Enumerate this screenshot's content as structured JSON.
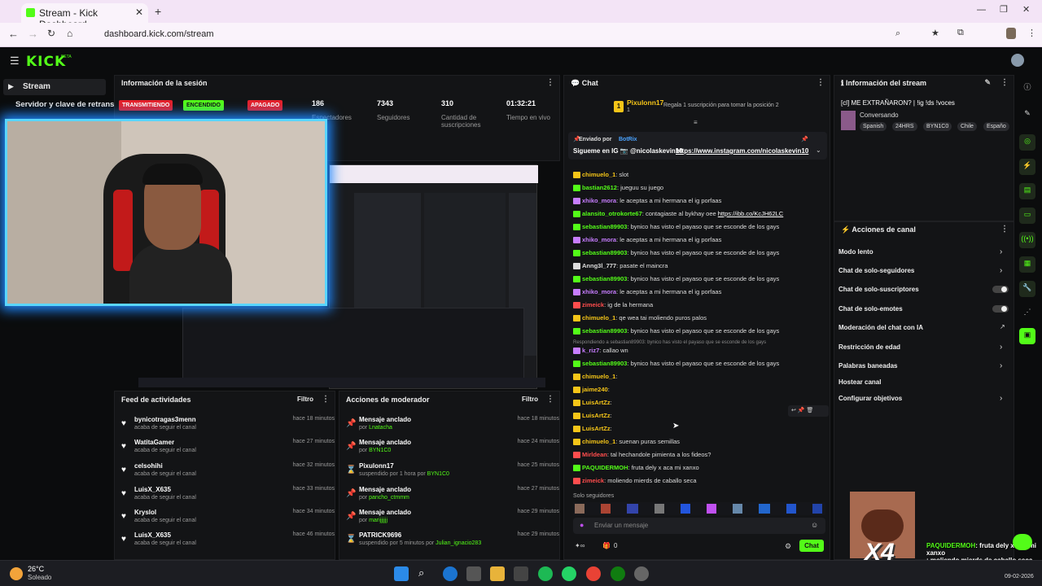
{
  "browser": {
    "tab_title": "Stream - Kick Dashboard",
    "url": "dashboard.kick.com/stream"
  },
  "kick": {
    "logo": "KICK",
    "logo_sub": "BETA"
  },
  "nav": {
    "stream": "Stream",
    "server": "Servidor y clave de retransm"
  },
  "session": {
    "title": "Información de la sesión",
    "badge1": "TRANSMITIENDO",
    "badge2": "ENCENDIDO",
    "badge3": "APAGADO",
    "stats": [
      {
        "n": "186",
        "l": "Espectadores"
      },
      {
        "n": "7343",
        "l": "Seguidores"
      },
      {
        "n": "310",
        "l": "Cantidad de suscripciones"
      },
      {
        "n": "01:32:21",
        "l": "Tiempo en vivo"
      }
    ]
  },
  "feed": {
    "title": "Feed de actividades",
    "filter": "Filtro",
    "items": [
      {
        "name": "bynicotragas3menn",
        "sub": "acaba de seguir el canal",
        "time": "hace 18 minutos"
      },
      {
        "name": "WatitaGamer",
        "sub": "acaba de seguir el canal",
        "time": "hace 27 minutos"
      },
      {
        "name": "celsohihi",
        "sub": "acaba de seguir el canal",
        "time": "hace 32 minutos"
      },
      {
        "name": "LuisX_X635",
        "sub": "acaba de seguir el canal",
        "time": "hace 33 minutos"
      },
      {
        "name": "Kryslol",
        "sub": "acaba de seguir el canal",
        "time": "hace 34 minutos"
      },
      {
        "name": "LuisX_X635",
        "sub": "acaba de seguir el canal",
        "time": "hace 46 minutos"
      }
    ]
  },
  "mod": {
    "title": "Acciones de moderador",
    "filter": "Filtro",
    "items": [
      {
        "name": "Mensaje anclado",
        "by": "por ",
        "who": "Lnatacha",
        "time": "hace 18 minutos",
        "icon": "pin"
      },
      {
        "name": "Mensaje anclado",
        "by": "por ",
        "who": "BYN1C0",
        "time": "hace 24 minutos",
        "icon": "pin"
      },
      {
        "name": "Pixulonn17",
        "by": "suspendido por 1 hora por ",
        "who": "BYN1C0",
        "time": "hace 25 minutos",
        "icon": "timer"
      },
      {
        "name": "Mensaje anclado",
        "by": "por ",
        "who": "pancho_ctmmm",
        "time": "hace 27 minutos",
        "icon": "pin"
      },
      {
        "name": "Mensaje anclado",
        "by": "por ",
        "who": "marijjjjjj",
        "time": "hace 29 minutos",
        "icon": "pin"
      },
      {
        "name": "PATRICK9696",
        "by": "suspendido por 5 minutos por ",
        "who": "Julian_ignacio283",
        "time": "hace 29 minutos",
        "icon": "timer"
      }
    ]
  },
  "chat": {
    "title": "Chat",
    "top_user": "Pixulonn17",
    "top_count": "1",
    "gift_text": "Regala 1 suscripción para tomar la posición 2",
    "pinned_by": "Enviado por",
    "pinned_bot": "BotRix",
    "pinned_msg": "Sigueme en IG 📷 @nicolaskevin10",
    "pinned_link": "https://www.instagram.com/nicolaskevin10",
    "messages": [
      {
        "u": "chimuelo_1",
        "c": "#f5c518",
        "t": ": slot"
      },
      {
        "u": "bastian2612",
        "c": "#53fc18",
        "t": ": jueguu su juego"
      },
      {
        "u": "xhiko_mora",
        "c": "#c77dff",
        "t": ": le aceptas a mi hermana el ig porfaas"
      },
      {
        "u": "alansito_otrokorte67",
        "c": "#53fc18",
        "t": ": contagiaste al bykhay oee ",
        "link": "https://ibb.co/KcJH62LC"
      },
      {
        "u": "sebastian89903",
        "c": "#53fc18",
        "t": ": bynico has visto el payaso que se esconde de los gays"
      },
      {
        "u": "xhiko_mora",
        "c": "#c77dff",
        "t": ": le aceptas a mi hermana el ig porfaas"
      },
      {
        "u": "sebastian89903",
        "c": "#53fc18",
        "t": ": bynico has visto el payaso que se esconde de los gays"
      },
      {
        "u": "Anng3l_777",
        "c": "#ddd",
        "t": ": pasate el maincra"
      },
      {
        "u": "sebastian89903",
        "c": "#53fc18",
        "t": ": bynico has visto el payaso que se esconde de los gays"
      },
      {
        "u": "xhiko_mora",
        "c": "#c77dff",
        "t": ": le aceptas a mi hermana el ig porfaas"
      },
      {
        "u": "zimeick",
        "c": "#ff4d4d",
        "t": ": ig de la hermana"
      },
      {
        "u": "chimuelo_1",
        "c": "#f5c518",
        "t": ": qe wea tai moliendo puros palos"
      },
      {
        "u": "sebastian89903",
        "c": "#53fc18",
        "t": ": bynico has visto el payaso que se esconde de los gays"
      },
      {
        "reply": "Respondiendo a sebastian89903: bynico has visto el payaso que se esconde de los gays"
      },
      {
        "u": "k_riz7",
        "c": "#c77dff",
        "t": ": callao wn"
      },
      {
        "u": "sebastian89903",
        "c": "#53fc18",
        "t": ": bynico has visto el payaso que se esconde de los gays"
      },
      {
        "u": "chimuelo_1",
        "c": "#f5c518",
        "t": ":"
      },
      {
        "u": "jaime240",
        "c": "#f5c518",
        "t": ":"
      },
      {
        "u": "LuisArtZz",
        "c": "#f5c518",
        "t": ":"
      },
      {
        "u": "LuisArtZz",
        "c": "#f5c518",
        "t": ":"
      },
      {
        "u": "LuisArtZz",
        "c": "#f5c518",
        "t": ":"
      },
      {
        "u": "chimuelo_1",
        "c": "#f5c518",
        "t": ": suenan puras semillas"
      },
      {
        "u": "Mirldean",
        "c": "#ff4d4d",
        "t": ": tal hechandole pimienta a los fideos?"
      },
      {
        "u": "PAQUIDERMOH",
        "c": "#53fc18",
        "t": ": fruta dely x aca mi xanxo"
      },
      {
        "u": "zimeick",
        "c": "#ff4d4d",
        "t": ": moliendo mierds de caballo seca"
      }
    ],
    "followers_only": "Solo seguidores",
    "placeholder": "Enviar un mensaje",
    "points": "0",
    "send": "Chat"
  },
  "stream_info": {
    "title": "Información del stream",
    "stream_title": "[cl] ME EXTRAÑARON? | !ig !ds !voces",
    "category": "Conversando",
    "tags": [
      "Spanish",
      "24HRS",
      "BYN1C0",
      "Chile",
      "Españo"
    ]
  },
  "channel_actions": {
    "title": "Acciones de canal",
    "items": [
      "Modo lento",
      "Chat de solo-seguidores",
      "Chat de solo-suscriptores",
      "Chat de solo-emotes",
      "Moderación del chat con IA",
      "Restricción de edad",
      "Palabras baneadas",
      "Hostear canal",
      "Configurar objetivos"
    ]
  },
  "overlay": {
    "x4": "X4",
    "msg1_user": "PAQUIDERMOH",
    "msg1_text": ": fruta dely x aca mi xanxo",
    "msg2_text": ": moliendo mierds de caballo seca"
  },
  "taskbar": {
    "temp": "26°C",
    "weather": "Soleado",
    "date": "09-02-2026"
  },
  "colors": {
    "kick_green": "#53fc18",
    "live_red": "#e5202a"
  }
}
